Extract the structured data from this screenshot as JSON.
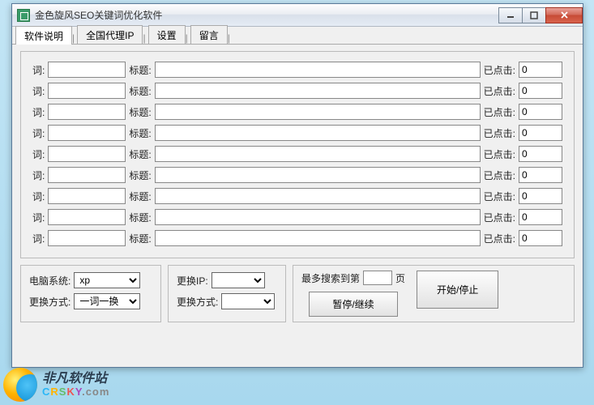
{
  "window": {
    "title": "金色旋风SEO关键词优化软件"
  },
  "tabs": [
    "软件说明",
    "全国代理IP",
    "设置",
    "留言"
  ],
  "labels": {
    "word": "词:",
    "title": "标题:",
    "clicked": "已点击:"
  },
  "rows": [
    {
      "word": "",
      "title": "",
      "clicked": "0"
    },
    {
      "word": "",
      "title": "",
      "clicked": "0"
    },
    {
      "word": "",
      "title": "",
      "clicked": "0"
    },
    {
      "word": "",
      "title": "",
      "clicked": "0"
    },
    {
      "word": "",
      "title": "",
      "clicked": "0"
    },
    {
      "word": "",
      "title": "",
      "clicked": "0"
    },
    {
      "word": "",
      "title": "",
      "clicked": "0"
    },
    {
      "word": "",
      "title": "",
      "clicked": "0"
    },
    {
      "word": "",
      "title": "",
      "clicked": "0"
    }
  ],
  "group1": {
    "os_label": "电脑系统:",
    "os_value": "xp",
    "switch_label": "更换方式:",
    "switch_value": "一词一换"
  },
  "group2": {
    "ip_label": "更换IP:",
    "ip_value": "",
    "method_label": "更换方式:",
    "method_value": ""
  },
  "group3": {
    "search_label_pre": "最多搜索到第",
    "search_value": "",
    "search_label_post": "页",
    "pause_btn": "暂停/继续",
    "start_btn": "开始/停止"
  },
  "watermark": {
    "cn": "非凡软件站",
    "en": "CRSKY.com"
  }
}
